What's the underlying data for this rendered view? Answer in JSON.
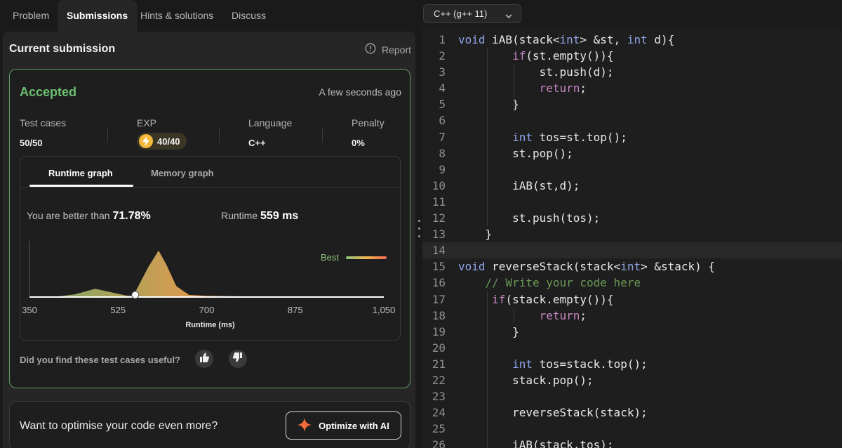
{
  "tabs": [
    "Problem",
    "Submissions",
    "Hints & solutions",
    "Discuss"
  ],
  "submission": {
    "heading": "Current submission",
    "report": "Report",
    "status": "Accepted",
    "time_ago": "A few seconds ago",
    "stats": {
      "test_cases_label": "Test cases",
      "test_cases_value": "50/50",
      "exp_label": "EXP",
      "exp_value": "40/40",
      "language_label": "Language",
      "language_value": "C++",
      "penalty_label": "Penalty",
      "penalty_value": "0%"
    },
    "graph_tabs": [
      "Runtime graph",
      "Memory graph"
    ],
    "better_label": "You are better than",
    "better_value": "71.78%",
    "runtime_label": "Runtime",
    "runtime_value": "559 ms",
    "best_label": "Best",
    "useful_question": "Did you find these test cases useful?",
    "optimise_text": "Want to optimise your code even more?",
    "optimize_button": "Optimize with AI"
  },
  "chart_data": {
    "type": "area",
    "xlabel": "Runtime (ms)",
    "xlim": [
      350,
      1050
    ],
    "x_ticks": [
      "350",
      "525",
      "700",
      "875",
      "1,050"
    ],
    "series": [
      {
        "x": [
          350,
          405,
          440,
          480,
          510,
          540,
          555,
          585,
          605,
          620,
          640,
          665,
          700,
          800,
          900,
          1050
        ],
        "y": [
          0,
          0.01,
          0.05,
          0.15,
          0.09,
          0.03,
          0.02,
          0.55,
          0.85,
          0.6,
          0.2,
          0.04,
          0.02,
          0.01,
          0.005,
          0.002
        ]
      }
    ],
    "user_runtime": 559,
    "colors": {
      "low": "#7ab06a",
      "mid": "#f0a050",
      "high": "#f06a50"
    }
  },
  "editor": {
    "language": "C++ (g++ 11)",
    "lines": [
      [
        {
          "t": "void",
          "c": "kw"
        },
        {
          "t": " iAB(stack<"
        },
        {
          "t": "int",
          "c": "kw"
        },
        {
          "t": "> &st, "
        },
        {
          "t": "int",
          "c": "kw"
        },
        {
          "t": " d){"
        }
      ],
      [
        {
          "t": "        "
        },
        {
          "t": "if",
          "c": "kw2"
        },
        {
          "t": "(st.empty()){"
        }
      ],
      [
        {
          "t": "            st.push(d);"
        }
      ],
      [
        {
          "t": "            "
        },
        {
          "t": "return",
          "c": "kw2"
        },
        {
          "t": ";"
        }
      ],
      [
        {
          "t": "        }"
        }
      ],
      [
        {
          "t": ""
        }
      ],
      [
        {
          "t": "        "
        },
        {
          "t": "int",
          "c": "kw"
        },
        {
          "t": " tos=st.top();"
        }
      ],
      [
        {
          "t": "        st.pop();"
        }
      ],
      [
        {
          "t": ""
        }
      ],
      [
        {
          "t": "        iAB(st,d);"
        }
      ],
      [
        {
          "t": ""
        }
      ],
      [
        {
          "t": "        st.push(tos);"
        }
      ],
      [
        {
          "t": "    }"
        }
      ],
      [
        {
          "t": ""
        }
      ],
      [
        {
          "t": "void",
          "c": "kw"
        },
        {
          "t": " reverseStack(stack<"
        },
        {
          "t": "int",
          "c": "kw"
        },
        {
          "t": "> &stack) {"
        }
      ],
      [
        {
          "t": "    "
        },
        {
          "t": "// Write your code here",
          "c": "cm"
        }
      ],
      [
        {
          "t": "     "
        },
        {
          "t": "if",
          "c": "kw2"
        },
        {
          "t": "(stack.empty()){"
        }
      ],
      [
        {
          "t": "            "
        },
        {
          "t": "return",
          "c": "kw2"
        },
        {
          "t": ";"
        }
      ],
      [
        {
          "t": "        }"
        }
      ],
      [
        {
          "t": ""
        }
      ],
      [
        {
          "t": "        "
        },
        {
          "t": "int",
          "c": "kw"
        },
        {
          "t": " tos=stack.top();"
        }
      ],
      [
        {
          "t": "        stack.pop();"
        }
      ],
      [
        {
          "t": ""
        }
      ],
      [
        {
          "t": "        reverseStack(stack);"
        }
      ],
      [
        {
          "t": ""
        }
      ],
      [
        {
          "t": "        iAB(stack,tos);"
        }
      ]
    ]
  }
}
